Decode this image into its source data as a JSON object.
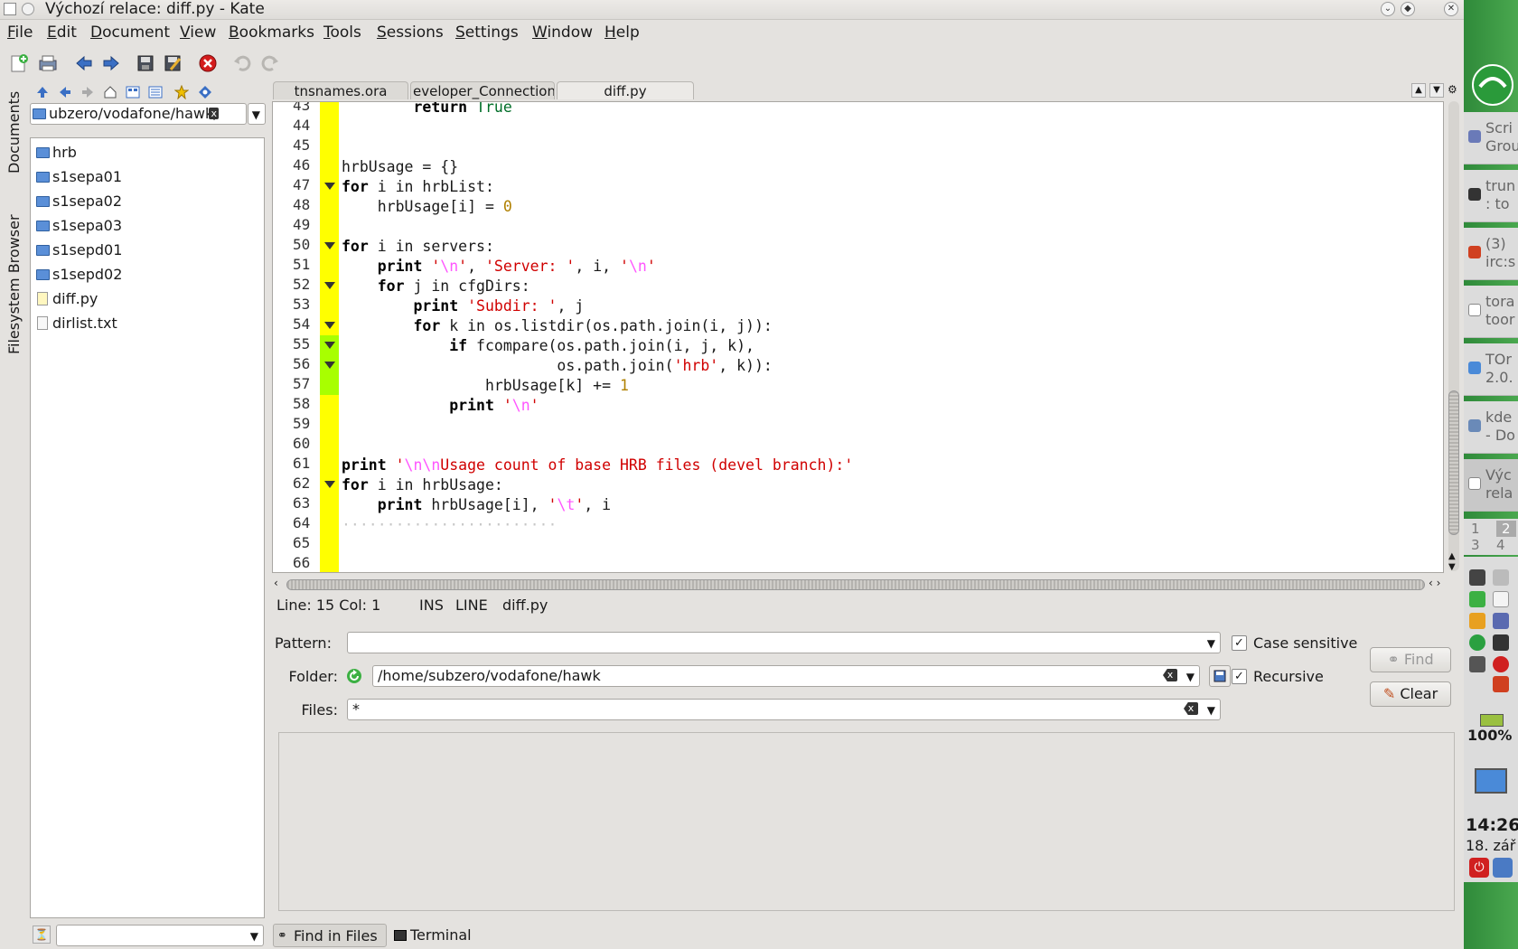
{
  "window": {
    "title": "Výchozí relace: diff.py - Kate",
    "min_glyph": "⌄",
    "max_glyph": "◆",
    "close_glyph": "✕"
  },
  "menu": [
    "File",
    "Edit",
    "Document",
    "View",
    "Bookmarks",
    "Tools",
    "Sessions",
    "Settings",
    "Window",
    "Help"
  ],
  "sidebar_tabs": {
    "documents": "Documents",
    "filesystem": "Filesystem Browser"
  },
  "filesystem": {
    "path": "ubzero/vodafone/hawk/",
    "items": [
      {
        "name": "hrb",
        "type": "folder"
      },
      {
        "name": "s1sepa01",
        "type": "folder"
      },
      {
        "name": "s1sepa02",
        "type": "folder"
      },
      {
        "name": "s1sepa03",
        "type": "folder"
      },
      {
        "name": "s1sepd01",
        "type": "folder"
      },
      {
        "name": "s1sepd02",
        "type": "folder"
      },
      {
        "name": "diff.py",
        "type": "python"
      },
      {
        "name": "dirlist.txt",
        "type": "text"
      }
    ],
    "filter_value": ""
  },
  "tabs": [
    "tnsnames.ora",
    "eveloper_Connection",
    "diff.py"
  ],
  "editor": {
    "line_numbers": [
      "43",
      "44",
      "45",
      "46",
      "47",
      "48",
      "49",
      "50",
      "51",
      "52",
      "53",
      "54",
      "55",
      "56",
      "57",
      "58",
      "59",
      "60",
      "61",
      "62",
      "63",
      "64",
      "65",
      "66"
    ]
  },
  "status": {
    "position": "Line: 15 Col: 1",
    "mode": "INS",
    "sel": "LINE",
    "file": "diff.py"
  },
  "find": {
    "pattern_label": "Pattern:",
    "pattern_value": "",
    "folder_label": "Folder:",
    "folder_value": "/home/subzero/vodafone/hawk",
    "files_label": "Files:",
    "files_value": "*",
    "case_sensitive_label": "Case sensitive",
    "recursive_label": "Recursive",
    "find_button": "Find",
    "clear_button": "Clear"
  },
  "bottom_tabs": {
    "find_in_files": "Find in Files",
    "terminal": "Terminal"
  },
  "taskbar": {
    "tasks": [
      {
        "line1": "Scri",
        "line2": "Grou"
      },
      {
        "line1": "trun",
        "line2": ": to"
      },
      {
        "line1": "(3)",
        "line2": "irc:s"
      },
      {
        "line1": "tora",
        "line2": "toor"
      },
      {
        "line1": "TOr",
        "line2": "2.0."
      },
      {
        "line1": "kde",
        "line2": "- Do"
      },
      {
        "line1": "Výc",
        "line2": "rela"
      }
    ],
    "pager": [
      "1",
      "2",
      "3",
      "4"
    ],
    "battery": "100%",
    "clock": "14:26",
    "date": "18. zář"
  }
}
